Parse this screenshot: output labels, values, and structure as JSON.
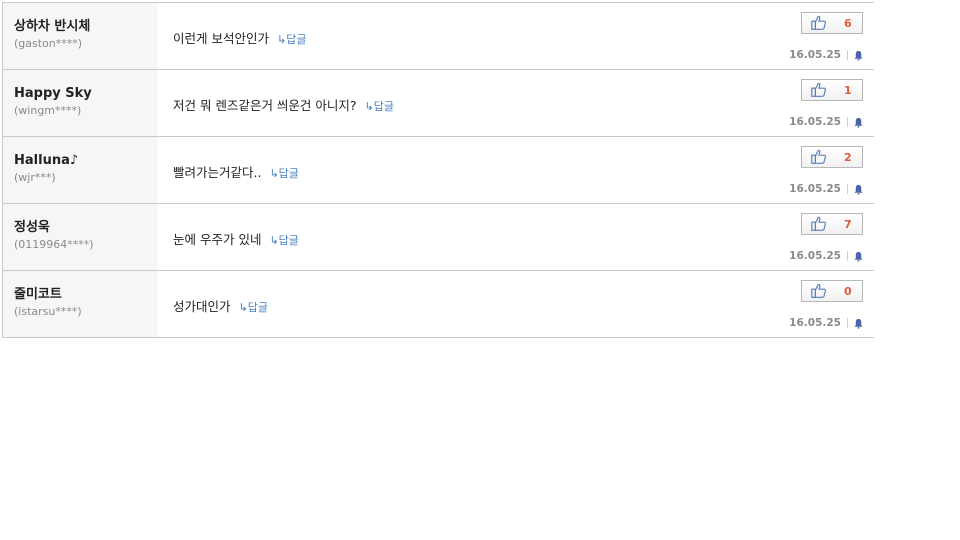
{
  "comments": [
    {
      "nickname": "상하차 반시체",
      "user_id": "(gaston****)",
      "text": "이런게 보석안인가",
      "reply_label": "답글",
      "likes": "6",
      "date": "16.05.25"
    },
    {
      "nickname": "Happy Sky",
      "user_id": "(wingm****)",
      "text": "저건 뭐 렌즈같은거 씌운건 아니지?",
      "reply_label": "답글",
      "likes": "1",
      "date": "16.05.25"
    },
    {
      "nickname": "Halluna♪",
      "user_id": "(wjr***)",
      "text": "빨려가는거같다..",
      "reply_label": "답글",
      "likes": "2",
      "date": "16.05.25"
    },
    {
      "nickname": "정성욱",
      "user_id": "(0119964****)",
      "text": "눈에 우주가 있네",
      "reply_label": "답글",
      "likes": "7",
      "date": "16.05.25"
    },
    {
      "nickname": "줄미코트",
      "user_id": "(istarsu****)",
      "text": "성가대인가",
      "reply_label": "답글",
      "likes": "0",
      "date": "16.05.25"
    }
  ],
  "icons": {
    "like": "thumbs-up-icon",
    "report": "bell-icon",
    "reply": "reply-arrow-icon"
  },
  "colors": {
    "like_count": "#e05b3a",
    "reply_link": "#4a7fbf",
    "author_bg": "#f6f6f6",
    "border": "#c8c8c8"
  }
}
